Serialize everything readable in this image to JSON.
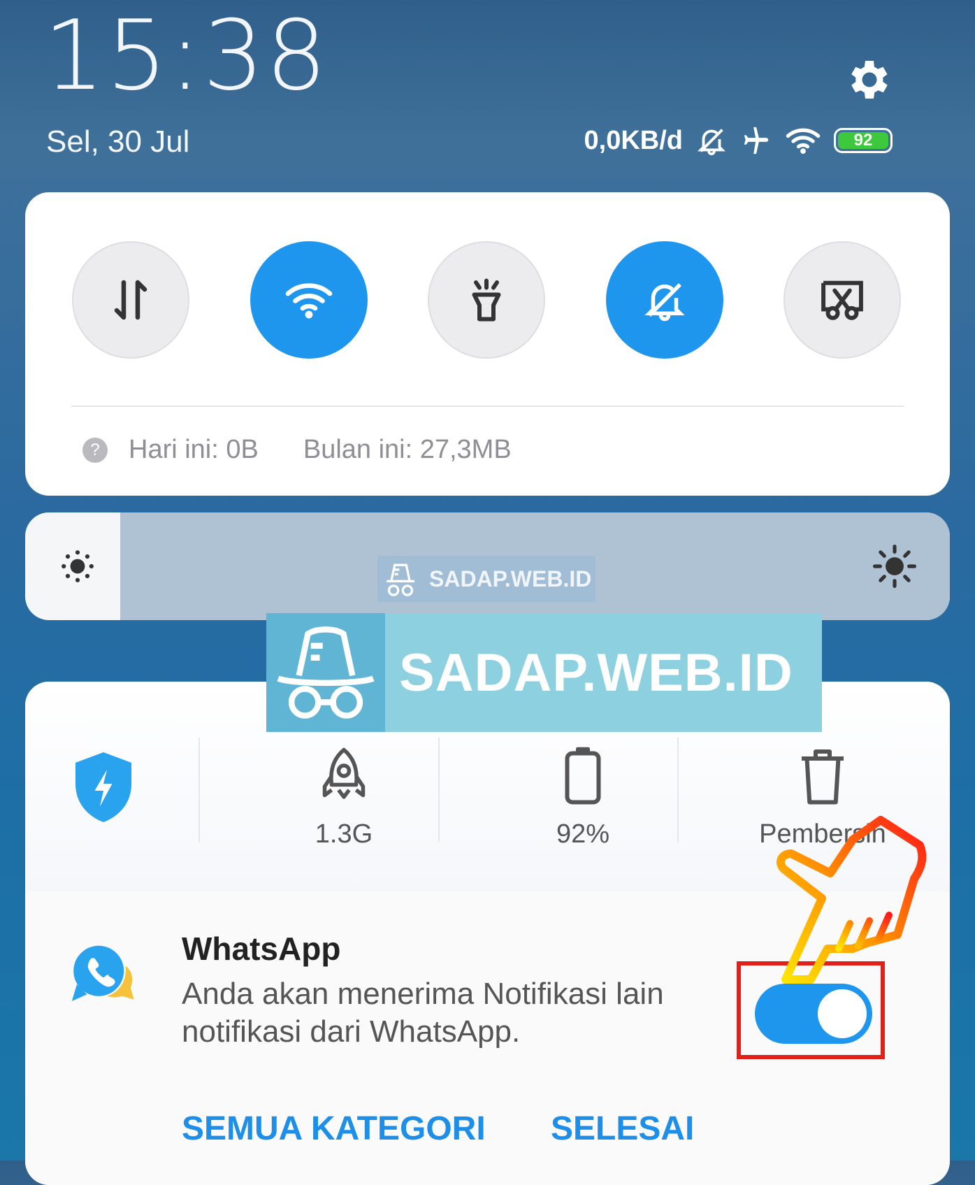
{
  "status": {
    "time": "15:38",
    "date": "Sel, 30 Jul",
    "net_speed": "0,0KB/d",
    "battery_level": "92",
    "icons": [
      "mute-icon",
      "airplane-icon",
      "wifi-icon",
      "battery-icon"
    ]
  },
  "quick_toggles": [
    {
      "name": "mobile-data",
      "icon": "data-arrows-icon",
      "on": false
    },
    {
      "name": "wifi",
      "icon": "wifi-icon",
      "on": true
    },
    {
      "name": "flashlight",
      "icon": "flashlight-icon",
      "on": false
    },
    {
      "name": "silent",
      "icon": "bell-off-icon",
      "on": true
    },
    {
      "name": "screenshot",
      "icon": "scissors-icon",
      "on": false
    }
  ],
  "data_usage": {
    "today": "Hari ini: 0B",
    "month": "Bulan ini: 27,3MB"
  },
  "watermark": {
    "small": "SADAP.WEB.ID",
    "big": "SADAP.WEB.ID"
  },
  "tools": {
    "ram": "1.3G",
    "battery": "92%",
    "cleaner": "Pembersih"
  },
  "notification": {
    "app": "WhatsApp",
    "message": "Anda akan menerima Notifikasi lain notifikasi dari WhatsApp.",
    "enabled": true,
    "all_categories": "SEMUA KATEGORI",
    "done": "SELESAI"
  },
  "colors": {
    "accent": "#1e96ee",
    "battery_green": "#3ec83e",
    "highlight_red": "#e0201a"
  }
}
